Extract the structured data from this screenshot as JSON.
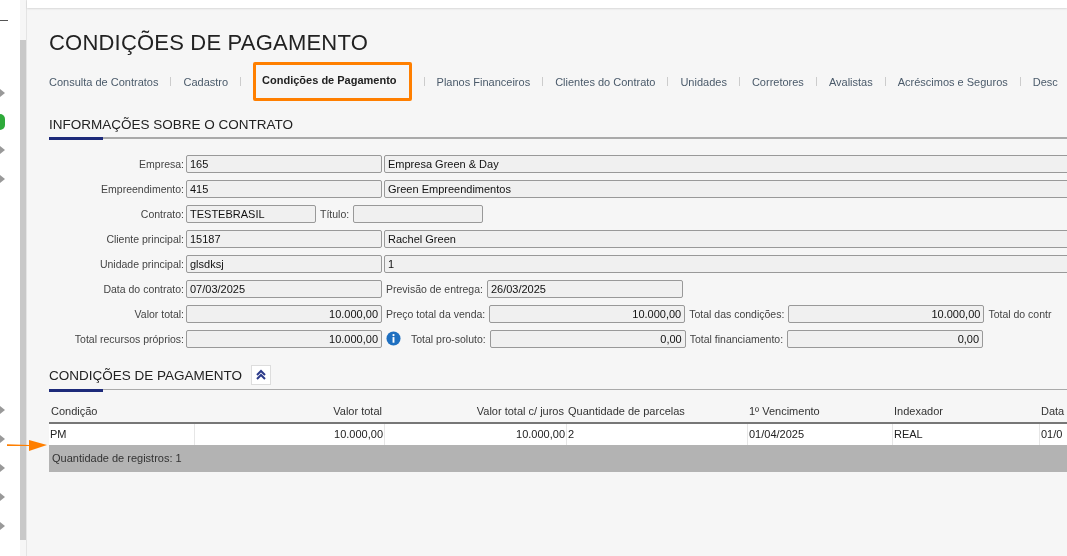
{
  "page": {
    "title": "CONDIÇÕES DE PAGAMENTO"
  },
  "tabs": [
    {
      "label": "Consulta de Contratos",
      "selected": false
    },
    {
      "label": "Cadastro",
      "selected": false
    },
    {
      "label": "Condições de Pagamento",
      "selected": true
    },
    {
      "label": "Planos Financeiros",
      "selected": false
    },
    {
      "label": "Clientes do Contrato",
      "selected": false
    },
    {
      "label": "Unidades",
      "selected": false
    },
    {
      "label": "Corretores",
      "selected": false
    },
    {
      "label": "Avalistas",
      "selected": false
    },
    {
      "label": "Acréscimos e Seguros",
      "selected": false
    },
    {
      "label": "Desc",
      "selected": false
    }
  ],
  "contract_info": {
    "title": "INFORMAÇÕES SOBRE O CONTRATO",
    "rows": [
      [
        {
          "kind": "label",
          "text": "Empresa:"
        },
        {
          "kind": "code",
          "value": "165"
        },
        {
          "kind": "name",
          "value": "Empresa Green & Day"
        }
      ],
      [
        {
          "kind": "label",
          "text": "Empreendimento:"
        },
        {
          "kind": "code",
          "value": "415"
        },
        {
          "kind": "name",
          "value": "Green Empreendimentos"
        }
      ],
      [
        {
          "kind": "label",
          "text": "Contrato:"
        },
        {
          "kind": "short",
          "value": "TESTEBRASIL"
        },
        {
          "kind": "label",
          "text": "Título:"
        },
        {
          "kind": "short"
        }
      ],
      [
        {
          "kind": "label",
          "text": "Cliente principal:"
        },
        {
          "kind": "code",
          "value": "15187"
        },
        {
          "kind": "name",
          "value": "Rachel Green"
        }
      ],
      [
        {
          "kind": "label",
          "text": "Unidade principal:"
        },
        {
          "kind": "code",
          "value": "glsdksj"
        },
        {
          "kind": "name",
          "value": "1"
        }
      ],
      [
        {
          "kind": "label",
          "text": "Data do contrato:"
        },
        {
          "kind": "code",
          "value": "07/03/2025"
        },
        {
          "kind": "label",
          "text": "Previsão de entrega:"
        },
        {
          "kind": "code",
          "value": "26/03/2025"
        }
      ],
      [
        {
          "kind": "label",
          "text": "Valor total:"
        },
        {
          "kind": "amount",
          "value": "10.000,00"
        },
        {
          "kind": "label",
          "text": "Preço total da venda:"
        },
        {
          "kind": "amount",
          "value": "10.000,00"
        },
        {
          "kind": "label",
          "text": "Total das condições:"
        },
        {
          "kind": "amount",
          "value": "10.000,00"
        },
        {
          "kind": "label",
          "text": "Total do contr"
        }
      ],
      [
        {
          "kind": "label",
          "text": "Total recursos próprios:"
        },
        {
          "kind": "amount",
          "value": "10.000,00",
          "info": true
        },
        {
          "kind": "label",
          "text": "Total pro-soluto:"
        },
        {
          "kind": "amount",
          "value": "0,00"
        },
        {
          "kind": "label",
          "text": "Total financiamento:"
        },
        {
          "kind": "amount",
          "value": "0,00"
        }
      ]
    ]
  },
  "payment_conditions": {
    "title": "CONDIÇÕES DE PAGAMENTO",
    "expanded": true,
    "columns": [
      {
        "label": "Condição",
        "kind": "text"
      },
      {
        "label": "Valor total",
        "kind": "amount"
      },
      {
        "label": "Valor total c/ juros",
        "kind": "amount"
      },
      {
        "label": "Quantidade de parcelas",
        "kind": "text"
      },
      {
        "label": "1º Vencimento",
        "kind": "text"
      },
      {
        "label": "Indexador",
        "kind": "text"
      },
      {
        "label": "Data",
        "kind": "text"
      }
    ],
    "rows": [
      [
        "PM",
        "10.000,00",
        "10.000,00",
        "2",
        "01/04/2025",
        "REAL",
        "01/0"
      ]
    ],
    "footer": "Quantidade de registros: 1"
  }
}
